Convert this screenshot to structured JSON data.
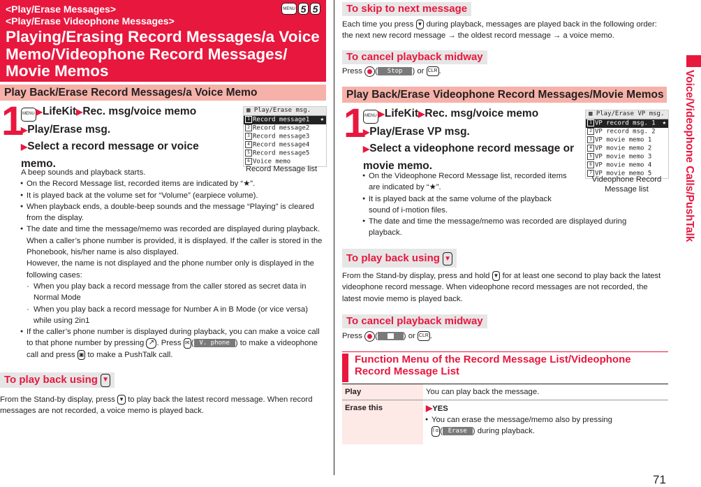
{
  "title_block": {
    "subtitle_1": "<Play/Erase Messages>",
    "subtitle_2": "<Play/Erase Videophone Messages>",
    "title": "Playing/Erasing Record Messages/a Voice Memo/Videophone Record Messages/ Movie Memos",
    "shortcut_keys": [
      "MENU",
      "5",
      "5"
    ]
  },
  "left": {
    "section_heading": "Play Back/Erase Record Messages/a Voice Memo",
    "step": {
      "number": "1",
      "menu_key": "MENU",
      "path": [
        "LifeKit",
        "Rec. msg/voice memo",
        "Play/Erase msg.",
        "Select a record message or voice memo."
      ],
      "intro": "A beep sounds and playback starts.",
      "bullets": [
        "On the Record Message list, recorded items are indicated by “★”.",
        "It is played back at the volume set for “Volume” (earpiece volume).",
        "When playback ends, a double-beep sounds and the message “Playing” is cleared from the display.",
        "The date and time the message/memo was recorded are displayed during playback. When a caller’s phone number is provided, it is displayed. If the caller is stored in the Phonebook, his/her name is also displayed."
      ],
      "however": "However, the name is not displayed and the phone number only is displayed in the following cases:",
      "cases": [
        "When you play back a record message from the caller stored as secret data in Normal Mode",
        "When you play back a record message for Number A in B Mode (or vice versa) while using 2in1"
      ],
      "last_bullet": {
        "part1": "If the caller’s phone number is displayed during playback, you can make a voice call to that phone number by pressing",
        "part2": ". Press",
        "softkey": "V. phone",
        "part3": ") to make a videophone call and press",
        "part4": "to make a PushTalk call."
      }
    },
    "screen": {
      "header": "Play/Erase msg.",
      "rows": [
        "Record message1",
        "Record message2",
        "Record message3",
        "Record message4",
        "Record message5",
        "Voice memo"
      ],
      "selected_index": 0,
      "star": "★",
      "caption": "Record Message list"
    },
    "play_back": {
      "heading": "To play back using",
      "text_1": "From the Stand-by display, press",
      "text_2": "to play back the latest record message. When record messages are not recorded, a voice memo is played back."
    }
  },
  "right": {
    "skip": {
      "heading": "To skip to next message",
      "text_1": "Each time you press",
      "text_2": "during playback, messages are played back in the following order: the next new record message → the oldest record message → a voice memo."
    },
    "cancel_1": {
      "heading": "To cancel playback midway",
      "press": "Press",
      "softkey": "Stop",
      "or": ") or",
      "clr": "CLR"
    },
    "section_heading": "Play Back/Erase Videophone Record Messages/Movie Memos",
    "step": {
      "number": "1",
      "menu_key": "MENU",
      "path": [
        "LifeKit",
        "Rec. msg/voice memo",
        "Play/Erase VP msg.",
        "Select a videophone record message or movie memo."
      ],
      "bullets": [
        "On the Videophone Record Message list, recorded items are indicated by “★”.",
        "It is played back at the same volume of the playback sound of i-motion files.",
        "The date and time the message/memo was recorded are displayed during playback."
      ]
    },
    "screen": {
      "header": "Play/Erase VP msg.",
      "rows": [
        "VP record msg. 1",
        "VP record msg. 2",
        "VP movie memo 1",
        "VP movie memo 2",
        "VP movie memo 3",
        "VP movie memo 4",
        "VP movie memo 5"
      ],
      "selected_index": 0,
      "star": "★",
      "caption": "Videophone Record Message list"
    },
    "play_back": {
      "heading": "To play back using",
      "text_1": "From the Stand-by display, press and hold",
      "text_2": "for at least one second to play back the latest videophone record message. When videophone record messages are not recorded, the latest movie memo is played back."
    },
    "cancel_2": {
      "heading": "To cancel playback midway",
      "press": "Press",
      "or": ") or",
      "clr": "CLR"
    },
    "function_menu": {
      "heading": "Function Menu of the Record Message List/Videophone Record Message List",
      "rows": [
        {
          "key": "Play",
          "value": "You can play back the message."
        },
        {
          "key": "Erase this",
          "value": "YES",
          "note_1": "You can erase the message/memo also by pressing",
          "softkey": "Erase",
          "note_2": ") during playback."
        }
      ]
    }
  },
  "side_label": "Voice/Videophone Calls/PushTalk",
  "page_number": "71"
}
